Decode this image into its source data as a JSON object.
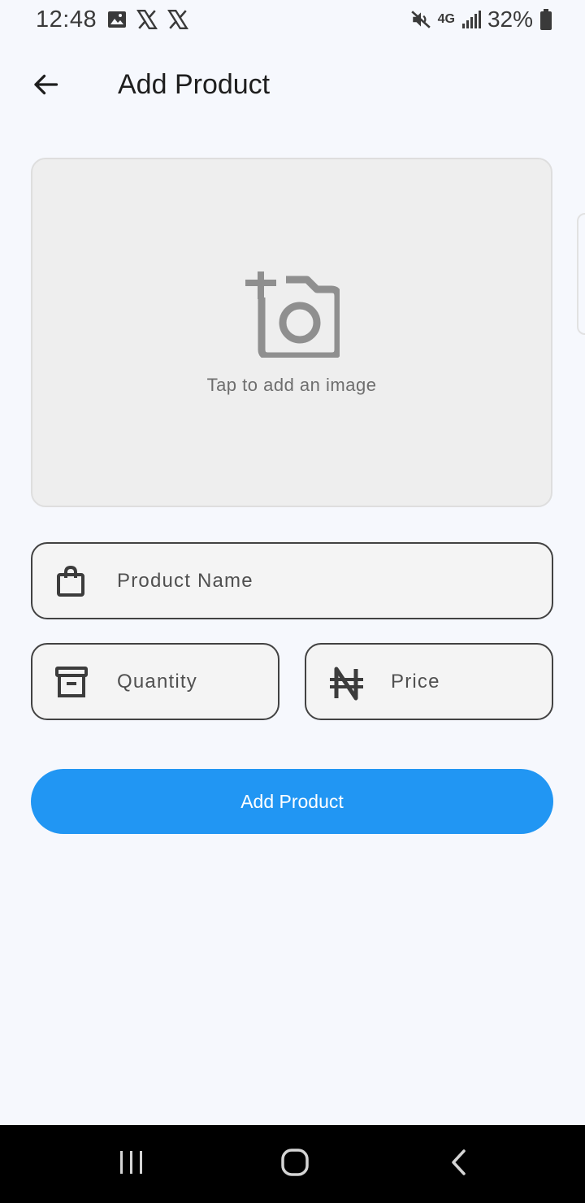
{
  "status_bar": {
    "time": "12:48",
    "battery": "32%",
    "network": "4G"
  },
  "app_bar": {
    "title": "Add Product"
  },
  "image_picker": {
    "hint": "Tap to add an image"
  },
  "form": {
    "product_name_label": "Product Name",
    "quantity_label": "Quantity",
    "price_label": "Price"
  },
  "submit_label": "Add Product",
  "colors": {
    "primary": "#2196f3",
    "background": "#f6f8fd",
    "field_border": "#424242"
  },
  "icons": [
    "gallery-icon",
    "x-logo-icon",
    "mute-icon",
    "signal-icon",
    "battery-icon",
    "back-arrow-icon",
    "add-photo-icon",
    "shopping-bag-icon",
    "archive-box-icon",
    "naira-icon",
    "recents-icon",
    "home-icon",
    "nav-back-icon"
  ]
}
